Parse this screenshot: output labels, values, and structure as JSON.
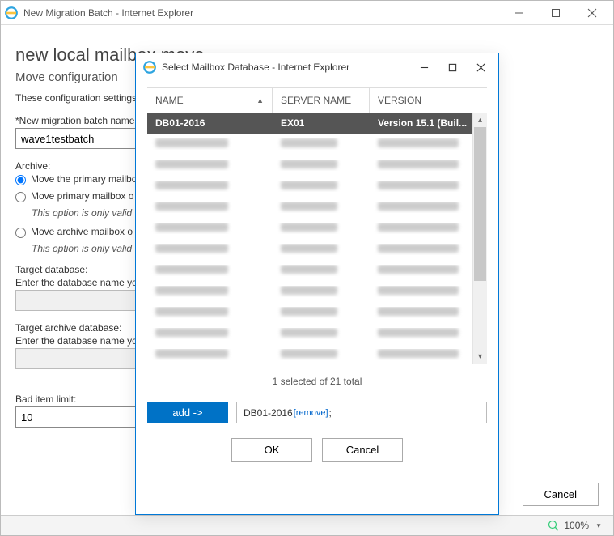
{
  "mainWindow": {
    "title": "New Migration Batch - Internet Explorer",
    "heading": "new local mailbox move",
    "subheading": "Move configuration",
    "description": "These configuration settings",
    "batchNameLabel": "*New migration batch name:",
    "batchNameValue": "wave1testbatch",
    "archiveLabel": "Archive:",
    "radio1": "Move the primary mailbox",
    "radio2": "Move primary mailbox o",
    "radio2note": "This option is only valid",
    "radio3": "Move archive mailbox o",
    "radio3note": "This option is only valid",
    "targetDbLabel": "Target database:",
    "targetDbDesc": "Enter the database name yo",
    "targetArchiveLabel": "Target archive database:",
    "targetArchiveDesc": "Enter the database name yo",
    "badItemLabel": "Bad item limit:",
    "badItemValue": "10",
    "cancelLabel": "Cancel",
    "zoom": "100%"
  },
  "modal": {
    "title": "Select Mailbox Database - Internet Explorer",
    "colName": "NAME",
    "colServer": "SERVER NAME",
    "colVersion": "VERSION",
    "rowName": "DB01-2016",
    "rowServer": "EX01",
    "rowVersion": "Version 15.1 (Buil...",
    "countLine": "1 selected of 21 total",
    "addLabel": "add ->",
    "selectedName": "DB01-2016",
    "removeLabel": "[remove]",
    "okLabel": "OK",
    "cancelLabel": "Cancel"
  }
}
